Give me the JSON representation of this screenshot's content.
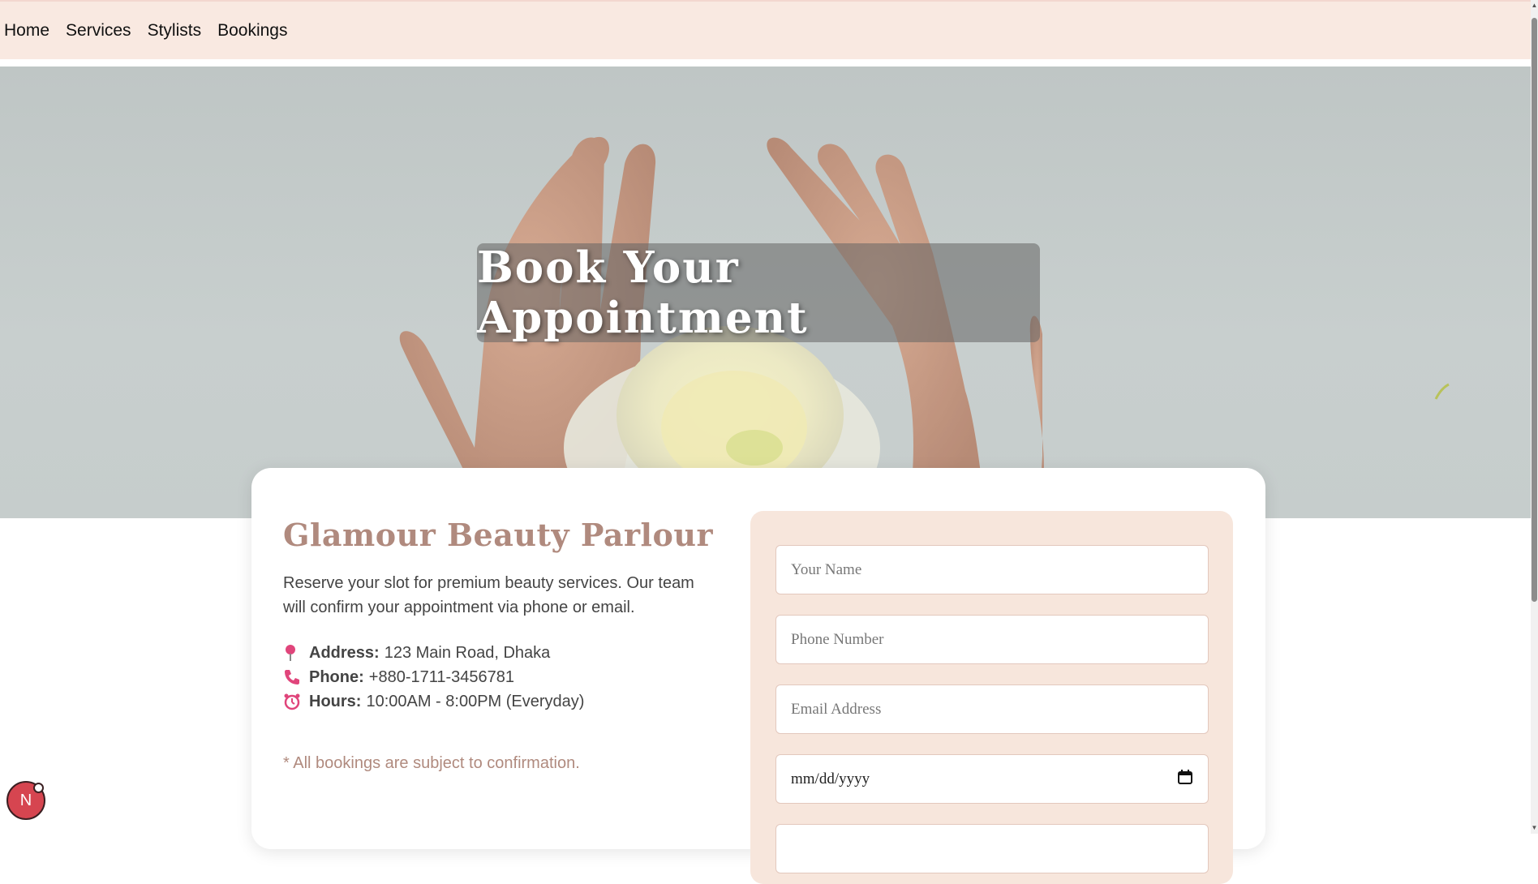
{
  "nav": {
    "items": [
      {
        "label": "Home"
      },
      {
        "label": "Services"
      },
      {
        "label": "Stylists"
      },
      {
        "label": "Bookings"
      }
    ]
  },
  "hero": {
    "title": "Book Your Appointment"
  },
  "info": {
    "brand": "Glamour Beauty Parlour",
    "description": "Reserve your slot for premium beauty services. Our team will confirm your appointment via phone or email.",
    "address_label": "Address:",
    "address_value": "123 Main Road, Dhaka",
    "phone_label": "Phone:",
    "phone_value": "+880-1711-3456781",
    "hours_label": "Hours:",
    "hours_value": "10:00AM - 8:00PM (Everyday)",
    "note": "* All bookings are subject to confirmation."
  },
  "form": {
    "name_placeholder": "Your Name",
    "phone_placeholder": "Phone Number",
    "email_placeholder": "Email Address",
    "date_placeholder": "mm/dd/yyyy"
  },
  "badge": {
    "letter": "N"
  },
  "colors": {
    "nav_bg": "#f9e9e1",
    "brand": "#b08a7e",
    "form_bg": "#f7e6dc",
    "field_border": "#e3c8bd",
    "accent_pink": "#e0457b"
  },
  "icons": {
    "address": "pin-icon",
    "phone": "phone-icon",
    "hours": "alarm-clock-icon",
    "date": "calendar-icon"
  }
}
